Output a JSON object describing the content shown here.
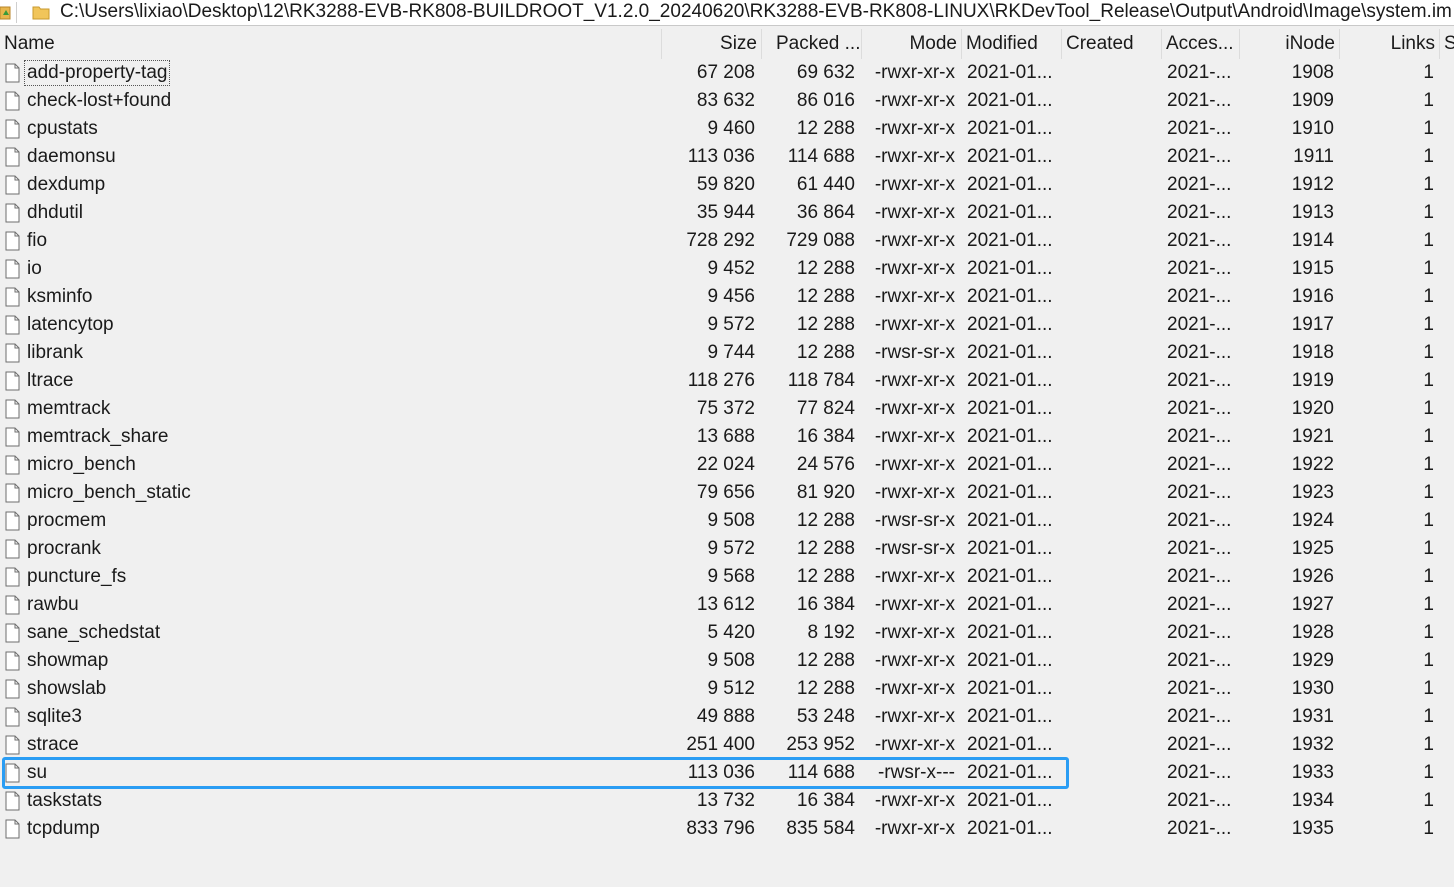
{
  "pathbar": {
    "path": "C:\\Users\\lixiao\\Desktop\\12\\RK3288-EVB-RK808-BUILDROOT_V1.2.0_20240620\\RK3288-EVB-RK808-LINUX\\RKDevTool_Release\\Output\\Android\\Image\\system.im",
    "up_icon": "up-folder-icon",
    "folder_icon": "folder-icon"
  },
  "columns": {
    "name": "Name",
    "size": "Size",
    "packed": "Packed ...",
    "mode": "Mode",
    "modified": "Modified",
    "created": "Created",
    "accessed": "Acces...",
    "inode": "iNode",
    "links": "Links",
    "extra": "S"
  },
  "colors": {
    "background": "#f0f0f0",
    "highlight": "#2a9df4"
  },
  "highlighted_file": "su",
  "files": [
    {
      "name": "add-property-tag",
      "size": "67 208",
      "packed": "69 632",
      "mode": "-rwxr-xr-x",
      "modified": "2021-01...",
      "created": "",
      "accessed": "2021-...",
      "inode": "1908",
      "links": "1"
    },
    {
      "name": "check-lost+found",
      "size": "83 632",
      "packed": "86 016",
      "mode": "-rwxr-xr-x",
      "modified": "2021-01...",
      "created": "",
      "accessed": "2021-...",
      "inode": "1909",
      "links": "1"
    },
    {
      "name": "cpustats",
      "size": "9 460",
      "packed": "12 288",
      "mode": "-rwxr-xr-x",
      "modified": "2021-01...",
      "created": "",
      "accessed": "2021-...",
      "inode": "1910",
      "links": "1"
    },
    {
      "name": "daemonsu",
      "size": "113 036",
      "packed": "114 688",
      "mode": "-rwxr-xr-x",
      "modified": "2021-01...",
      "created": "",
      "accessed": "2021-...",
      "inode": "1911",
      "links": "1"
    },
    {
      "name": "dexdump",
      "size": "59 820",
      "packed": "61 440",
      "mode": "-rwxr-xr-x",
      "modified": "2021-01...",
      "created": "",
      "accessed": "2021-...",
      "inode": "1912",
      "links": "1"
    },
    {
      "name": "dhdutil",
      "size": "35 944",
      "packed": "36 864",
      "mode": "-rwxr-xr-x",
      "modified": "2021-01...",
      "created": "",
      "accessed": "2021-...",
      "inode": "1913",
      "links": "1"
    },
    {
      "name": "fio",
      "size": "728 292",
      "packed": "729 088",
      "mode": "-rwxr-xr-x",
      "modified": "2021-01...",
      "created": "",
      "accessed": "2021-...",
      "inode": "1914",
      "links": "1"
    },
    {
      "name": "io",
      "size": "9 452",
      "packed": "12 288",
      "mode": "-rwxr-xr-x",
      "modified": "2021-01...",
      "created": "",
      "accessed": "2021-...",
      "inode": "1915",
      "links": "1"
    },
    {
      "name": "ksminfo",
      "size": "9 456",
      "packed": "12 288",
      "mode": "-rwxr-xr-x",
      "modified": "2021-01...",
      "created": "",
      "accessed": "2021-...",
      "inode": "1916",
      "links": "1"
    },
    {
      "name": "latencytop",
      "size": "9 572",
      "packed": "12 288",
      "mode": "-rwxr-xr-x",
      "modified": "2021-01...",
      "created": "",
      "accessed": "2021-...",
      "inode": "1917",
      "links": "1"
    },
    {
      "name": "librank",
      "size": "9 744",
      "packed": "12 288",
      "mode": "-rwsr-sr-x",
      "modified": "2021-01...",
      "created": "",
      "accessed": "2021-...",
      "inode": "1918",
      "links": "1"
    },
    {
      "name": "ltrace",
      "size": "118 276",
      "packed": "118 784",
      "mode": "-rwxr-xr-x",
      "modified": "2021-01...",
      "created": "",
      "accessed": "2021-...",
      "inode": "1919",
      "links": "1"
    },
    {
      "name": "memtrack",
      "size": "75 372",
      "packed": "77 824",
      "mode": "-rwxr-xr-x",
      "modified": "2021-01...",
      "created": "",
      "accessed": "2021-...",
      "inode": "1920",
      "links": "1"
    },
    {
      "name": "memtrack_share",
      "size": "13 688",
      "packed": "16 384",
      "mode": "-rwxr-xr-x",
      "modified": "2021-01...",
      "created": "",
      "accessed": "2021-...",
      "inode": "1921",
      "links": "1"
    },
    {
      "name": "micro_bench",
      "size": "22 024",
      "packed": "24 576",
      "mode": "-rwxr-xr-x",
      "modified": "2021-01...",
      "created": "",
      "accessed": "2021-...",
      "inode": "1922",
      "links": "1"
    },
    {
      "name": "micro_bench_static",
      "size": "79 656",
      "packed": "81 920",
      "mode": "-rwxr-xr-x",
      "modified": "2021-01...",
      "created": "",
      "accessed": "2021-...",
      "inode": "1923",
      "links": "1"
    },
    {
      "name": "procmem",
      "size": "9 508",
      "packed": "12 288",
      "mode": "-rwsr-sr-x",
      "modified": "2021-01...",
      "created": "",
      "accessed": "2021-...",
      "inode": "1924",
      "links": "1"
    },
    {
      "name": "procrank",
      "size": "9 572",
      "packed": "12 288",
      "mode": "-rwsr-sr-x",
      "modified": "2021-01...",
      "created": "",
      "accessed": "2021-...",
      "inode": "1925",
      "links": "1"
    },
    {
      "name": "puncture_fs",
      "size": "9 568",
      "packed": "12 288",
      "mode": "-rwxr-xr-x",
      "modified": "2021-01...",
      "created": "",
      "accessed": "2021-...",
      "inode": "1926",
      "links": "1"
    },
    {
      "name": "rawbu",
      "size": "13 612",
      "packed": "16 384",
      "mode": "-rwxr-xr-x",
      "modified": "2021-01...",
      "created": "",
      "accessed": "2021-...",
      "inode": "1927",
      "links": "1"
    },
    {
      "name": "sane_schedstat",
      "size": "5 420",
      "packed": "8 192",
      "mode": "-rwxr-xr-x",
      "modified": "2021-01...",
      "created": "",
      "accessed": "2021-...",
      "inode": "1928",
      "links": "1"
    },
    {
      "name": "showmap",
      "size": "9 508",
      "packed": "12 288",
      "mode": "-rwxr-xr-x",
      "modified": "2021-01...",
      "created": "",
      "accessed": "2021-...",
      "inode": "1929",
      "links": "1"
    },
    {
      "name": "showslab",
      "size": "9 512",
      "packed": "12 288",
      "mode": "-rwxr-xr-x",
      "modified": "2021-01...",
      "created": "",
      "accessed": "2021-...",
      "inode": "1930",
      "links": "1"
    },
    {
      "name": "sqlite3",
      "size": "49 888",
      "packed": "53 248",
      "mode": "-rwxr-xr-x",
      "modified": "2021-01...",
      "created": "",
      "accessed": "2021-...",
      "inode": "1931",
      "links": "1"
    },
    {
      "name": "strace",
      "size": "251 400",
      "packed": "253 952",
      "mode": "-rwxr-xr-x",
      "modified": "2021-01...",
      "created": "",
      "accessed": "2021-...",
      "inode": "1932",
      "links": "1"
    },
    {
      "name": "su",
      "size": "113 036",
      "packed": "114 688",
      "mode": "-rwsr-x---",
      "modified": "2021-01...",
      "created": "",
      "accessed": "2021-...",
      "inode": "1933",
      "links": "1"
    },
    {
      "name": "taskstats",
      "size": "13 732",
      "packed": "16 384",
      "mode": "-rwxr-xr-x",
      "modified": "2021-01...",
      "created": "",
      "accessed": "2021-...",
      "inode": "1934",
      "links": "1"
    },
    {
      "name": "tcpdump",
      "size": "833 796",
      "packed": "835 584",
      "mode": "-rwxr-xr-x",
      "modified": "2021-01...",
      "created": "",
      "accessed": "2021-...",
      "inode": "1935",
      "links": "1"
    }
  ]
}
